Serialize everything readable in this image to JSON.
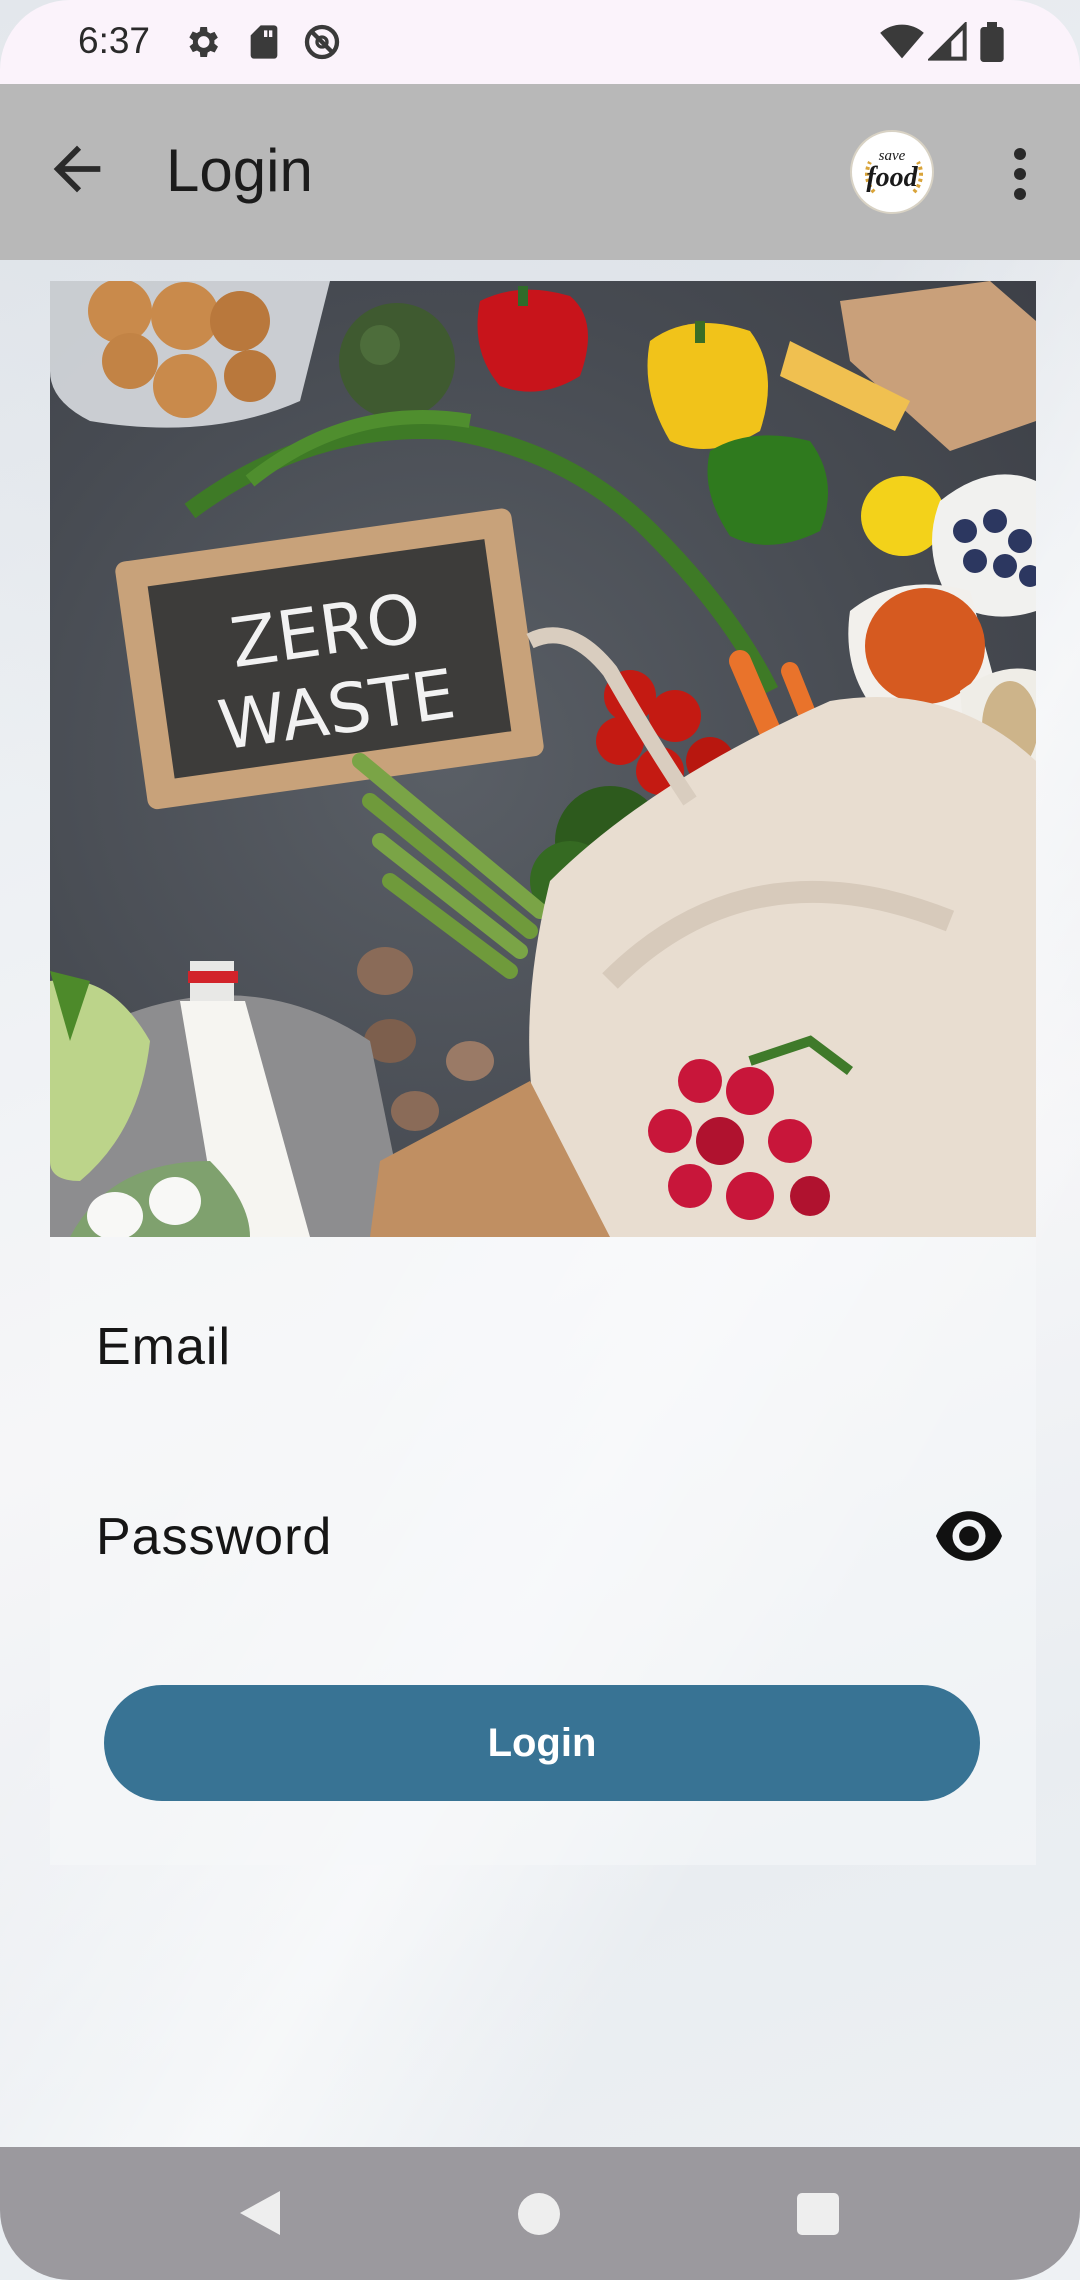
{
  "status_bar": {
    "time": "6:37",
    "icons_left": [
      "settings-icon",
      "sd-card-icon",
      "dnd-icon"
    ],
    "icons_right": [
      "wifi-icon",
      "signal-icon",
      "battery-icon"
    ]
  },
  "app_bar": {
    "title": "Login",
    "logo_line1": "save",
    "logo_line2": "food"
  },
  "hero": {
    "sign_line1": "ZERO",
    "sign_line2": "WASTE"
  },
  "form": {
    "email_label": "Email",
    "password_label": "Password",
    "login_label": "Login"
  },
  "colors": {
    "app_bar": "#b8b8b8",
    "primary_button": "#387394",
    "nav_bar": "#9b999e"
  }
}
